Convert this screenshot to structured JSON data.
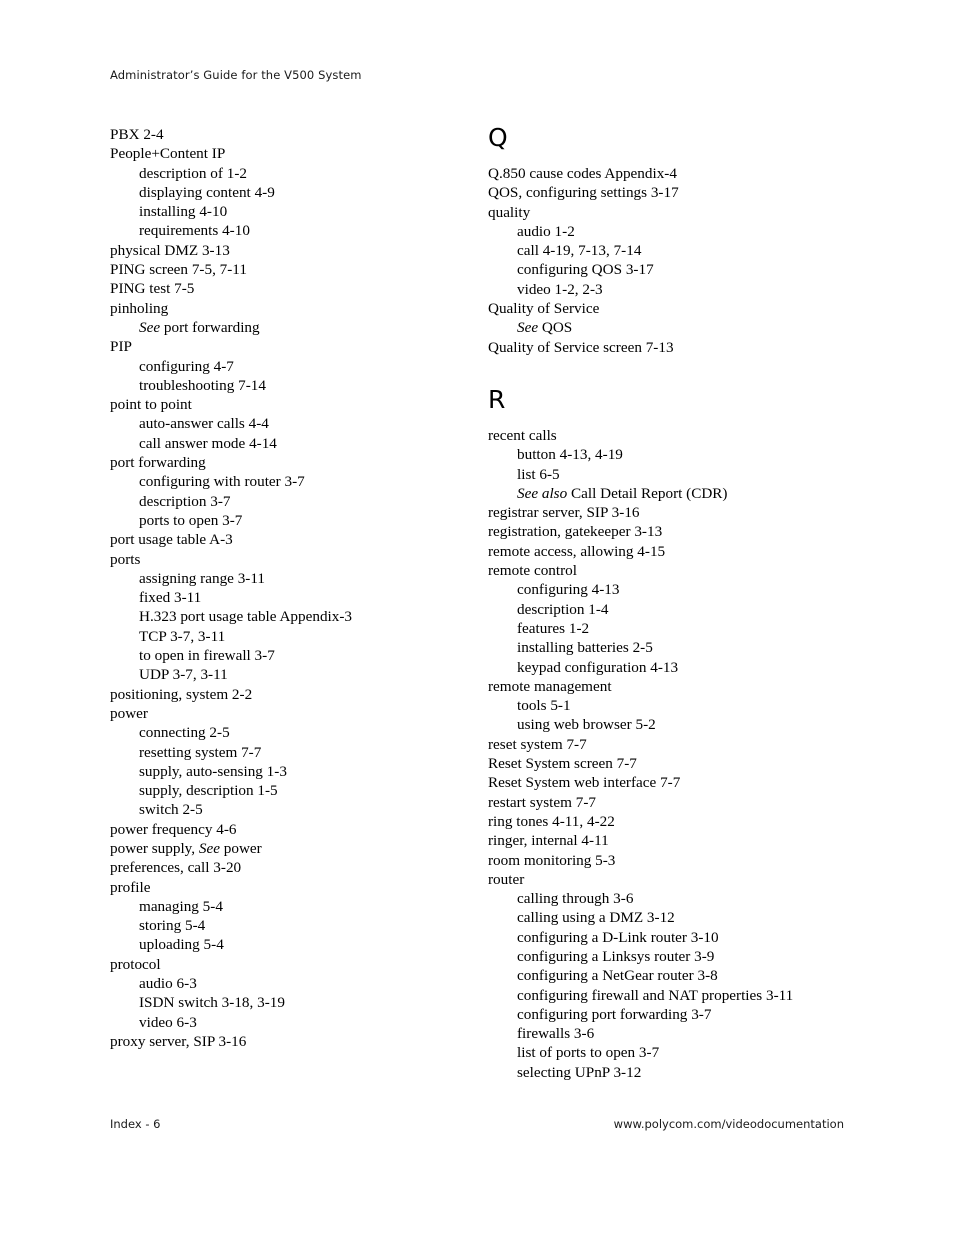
{
  "header": {
    "running_title": "Administrator’s Guide for the V500 System"
  },
  "footer": {
    "page_label": "Index - 6",
    "url": "www.polycom.com/videodocumentation"
  },
  "columns": {
    "left": {
      "sections": [
        {
          "letter": "",
          "entries": [
            {
              "level": 1,
              "text": "PBX 2-4"
            },
            {
              "level": 1,
              "text": "People+Content IP"
            },
            {
              "level": 2,
              "text": "description of 1-2"
            },
            {
              "level": 2,
              "text": "displaying content 4-9"
            },
            {
              "level": 2,
              "text": "installing 4-10"
            },
            {
              "level": 2,
              "text": "requirements 4-10"
            },
            {
              "level": 1,
              "text": "physical DMZ 3-13"
            },
            {
              "level": 1,
              "text": "PING screen 7-5, 7-11"
            },
            {
              "level": 1,
              "text": "PING test 7-5"
            },
            {
              "level": 1,
              "text": "pinholing"
            },
            {
              "level": 2,
              "italic_prefix": "See",
              "text": " port forwarding"
            },
            {
              "level": 1,
              "text": "PIP"
            },
            {
              "level": 2,
              "text": "configuring 4-7"
            },
            {
              "level": 2,
              "text": "troubleshooting 7-14"
            },
            {
              "level": 1,
              "text": "point to point"
            },
            {
              "level": 2,
              "text": "auto-answer calls 4-4"
            },
            {
              "level": 2,
              "text": "call answer mode 4-14"
            },
            {
              "level": 1,
              "text": "port forwarding"
            },
            {
              "level": 2,
              "text": "configuring with router 3-7"
            },
            {
              "level": 2,
              "text": "description 3-7"
            },
            {
              "level": 2,
              "text": "ports to open 3-7"
            },
            {
              "level": 1,
              "text": "port usage table A-3"
            },
            {
              "level": 1,
              "text": "ports"
            },
            {
              "level": 2,
              "text": "assigning range 3-11"
            },
            {
              "level": 2,
              "text": "fixed 3-11"
            },
            {
              "level": 2,
              "text": "H.323 port usage table Appendix-3"
            },
            {
              "level": 2,
              "text": "TCP 3-7, 3-11"
            },
            {
              "level": 2,
              "text": "to open in firewall 3-7"
            },
            {
              "level": 2,
              "text": "UDP 3-7, 3-11"
            },
            {
              "level": 1,
              "text": "positioning, system 2-2"
            },
            {
              "level": 1,
              "text": "power"
            },
            {
              "level": 2,
              "text": "connecting 2-5"
            },
            {
              "level": 2,
              "text": "resetting system 7-7"
            },
            {
              "level": 2,
              "text": "supply, auto-sensing 1-3"
            },
            {
              "level": 2,
              "text": "supply, description 1-5"
            },
            {
              "level": 2,
              "text": "switch 2-5"
            },
            {
              "level": 1,
              "text": "power frequency 4-6"
            },
            {
              "level": 1,
              "prefix": "power supply, ",
              "italic_mid": "See",
              "text": " power"
            },
            {
              "level": 1,
              "text": "preferences, call 3-20"
            },
            {
              "level": 1,
              "text": "profile"
            },
            {
              "level": 2,
              "text": "managing 5-4"
            },
            {
              "level": 2,
              "text": "storing 5-4"
            },
            {
              "level": 2,
              "text": "uploading 5-4"
            },
            {
              "level": 1,
              "text": "protocol"
            },
            {
              "level": 2,
              "text": "audio 6-3"
            },
            {
              "level": 2,
              "text": "ISDN switch 3-18, 3-19"
            },
            {
              "level": 2,
              "text": "video 6-3"
            },
            {
              "level": 1,
              "text": "proxy server, SIP 3-16"
            }
          ]
        }
      ]
    },
    "right": {
      "sections": [
        {
          "letter": "Q",
          "entries": [
            {
              "level": 1,
              "text": "Q.850 cause codes Appendix-4"
            },
            {
              "level": 1,
              "text": "QOS, configuring settings 3-17"
            },
            {
              "level": 1,
              "text": "quality"
            },
            {
              "level": 2,
              "text": "audio 1-2"
            },
            {
              "level": 2,
              "text": "call 4-19, 7-13, 7-14"
            },
            {
              "level": 2,
              "text": "configuring QOS 3-17"
            },
            {
              "level": 2,
              "text": "video 1-2, 2-3"
            },
            {
              "level": 1,
              "text": "Quality of Service"
            },
            {
              "level": 2,
              "italic_prefix": "See",
              "text": " QOS"
            },
            {
              "level": 1,
              "text": "Quality of Service screen 7-13"
            }
          ]
        },
        {
          "letter": "R",
          "entries": [
            {
              "level": 1,
              "text": "recent calls"
            },
            {
              "level": 2,
              "text": "button 4-13, 4-19"
            },
            {
              "level": 2,
              "text": "list 6-5"
            },
            {
              "level": 2,
              "italic_prefix": "See also",
              "text": " Call Detail Report (CDR)"
            },
            {
              "level": 1,
              "text": "registrar server, SIP 3-16"
            },
            {
              "level": 1,
              "text": "registration, gatekeeper 3-13"
            },
            {
              "level": 1,
              "text": "remote access, allowing 4-15"
            },
            {
              "level": 1,
              "text": "remote control"
            },
            {
              "level": 2,
              "text": "configuring 4-13"
            },
            {
              "level": 2,
              "text": "description 1-4"
            },
            {
              "level": 2,
              "text": "features 1-2"
            },
            {
              "level": 2,
              "text": "installing batteries 2-5"
            },
            {
              "level": 2,
              "text": "keypad configuration 4-13"
            },
            {
              "level": 1,
              "text": "remote management"
            },
            {
              "level": 2,
              "text": "tools 5-1"
            },
            {
              "level": 2,
              "text": "using web browser 5-2"
            },
            {
              "level": 1,
              "text": "reset system 7-7"
            },
            {
              "level": 1,
              "text": "Reset System screen 7-7"
            },
            {
              "level": 1,
              "text": "Reset System web interface 7-7"
            },
            {
              "level": 1,
              "text": "restart system 7-7"
            },
            {
              "level": 1,
              "text": "ring tones 4-11, 4-22"
            },
            {
              "level": 1,
              "text": "ringer, internal 4-11"
            },
            {
              "level": 1,
              "text": "room monitoring 5-3"
            },
            {
              "level": 1,
              "text": "router"
            },
            {
              "level": 2,
              "text": "calling through 3-6"
            },
            {
              "level": 2,
              "text": "calling using a DMZ 3-12"
            },
            {
              "level": 2,
              "text": "configuring a D-Link router 3-10"
            },
            {
              "level": 2,
              "text": "configuring a Linksys router 3-9"
            },
            {
              "level": 2,
              "text": "configuring a NetGear router 3-8"
            },
            {
              "level": 2,
              "text": "configuring firewall and NAT properties 3-11"
            },
            {
              "level": 2,
              "text": "configuring port forwarding 3-7"
            },
            {
              "level": 2,
              "text": "firewalls 3-6"
            },
            {
              "level": 2,
              "text": "list of ports to open 3-7"
            },
            {
              "level": 2,
              "text": "selecting UPnP 3-12"
            }
          ]
        }
      ]
    }
  }
}
